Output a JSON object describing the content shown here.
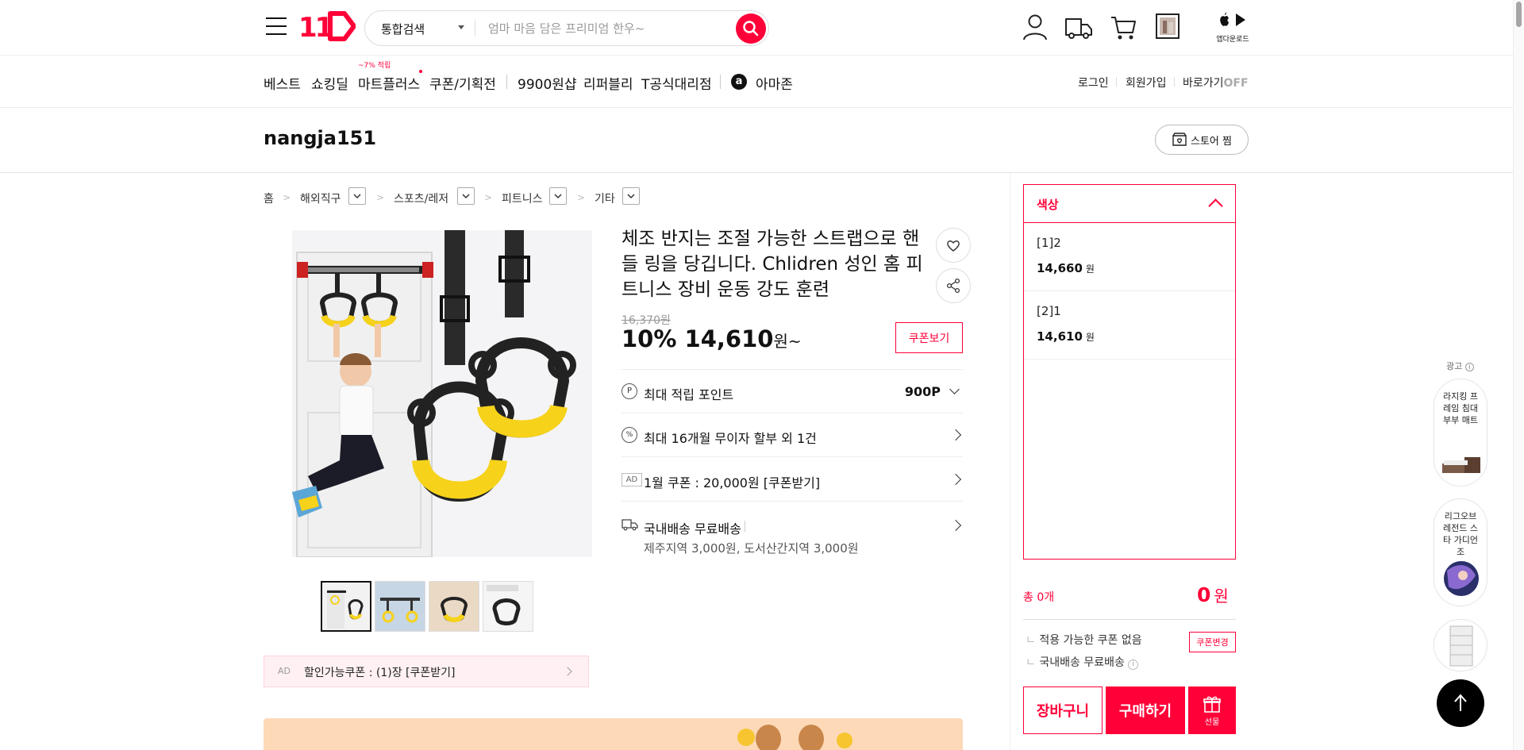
{
  "header": {
    "logo": "11",
    "search_scope": "통합검색",
    "search_placeholder": "엄마 마음 담은 프리미엄 한우~",
    "app_download": "앱다운로드"
  },
  "gnb": {
    "items": [
      "베스트",
      "쇼킹딜",
      "마트플러스",
      "쿠폰/기획전",
      "9900원샵",
      "리퍼블리",
      "T공식대리점",
      "아마존"
    ],
    "mart_badge": "~7% 적립",
    "util": [
      "로그인",
      "회원가입"
    ],
    "shortcut": "바로가기",
    "shortcut_state": "OFF"
  },
  "store": {
    "name": "nangja151",
    "follow_label": "스토어 찜"
  },
  "breadcrumb": [
    "홈",
    "해외직구",
    "스포츠/레저",
    "피트니스",
    "기타"
  ],
  "product": {
    "title": "체조 반지는 조절 가능한 스트랩으로 핸들 링을 당깁니다. Chlidren 성인 홈 피트니스 장비 운동 강도 훈련",
    "original_price": "16,370원",
    "discount": "10%",
    "price": "14,610",
    "price_unit": "원~",
    "coupon_button": "쿠폰보기",
    "points_label": "최대 적립 포인트",
    "points_value": "900P",
    "installment": "최대 16개월 무이자 할부 외 1건",
    "ad_coupon": "1월 쿠폰 : 20,000원 [쿠폰받기]",
    "ad_tag": "AD",
    "shipping": "국내배송 무료배송",
    "shipping_extra": "제주지역 3,000원, 도서산간지역 3,000원",
    "coupon_bar": "할인가능쿠폰 : (1)장 [쿠폰받기]"
  },
  "options": {
    "header": "색상",
    "items": [
      {
        "name": "[1]2",
        "price": "14,660",
        "unit": "원"
      },
      {
        "name": "[2]1",
        "price": "14,610",
        "unit": "원"
      }
    ]
  },
  "summary": {
    "count": "총 0개",
    "total": "0",
    "total_unit": "원",
    "coupon_note": "적용 가능한 쿠폰 없음",
    "coupon_change": "쿠폰변경",
    "shipping_note": "국내배송 무료배송",
    "cart": "장바구니",
    "buy": "구매하기",
    "gift": "선물"
  },
  "ads": {
    "label": "광고",
    "cards": [
      "라지킹 프레임 침대 부부 매트",
      "리그오브레전드 스타 가디언 조"
    ]
  },
  "colors": {
    "brand": "#ff0038",
    "banner": "#fdd9b8",
    "ring_yellow": "#f6d21a"
  }
}
